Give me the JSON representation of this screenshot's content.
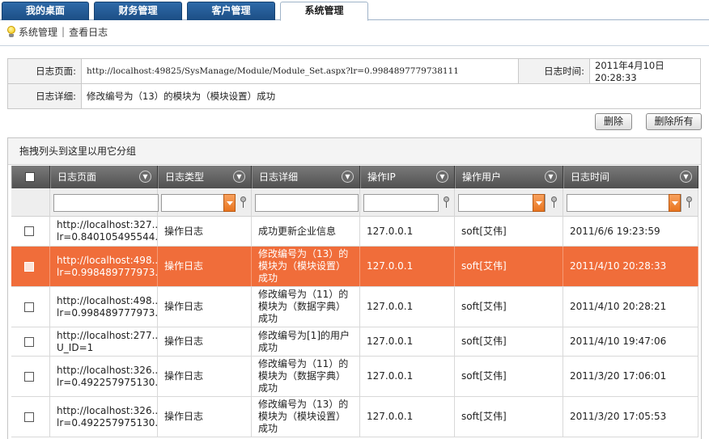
{
  "tabs": [
    {
      "label": "我的桌面",
      "active": false
    },
    {
      "label": "财务管理",
      "active": false
    },
    {
      "label": "客户管理",
      "active": false
    },
    {
      "label": "系统管理",
      "active": true
    }
  ],
  "breadcrumb": {
    "section": "系统管理",
    "separator": "|",
    "page": "查看日志"
  },
  "detail": {
    "page_label": "日志页面:",
    "page_value": "http://localhost:49825/SysManage/Module/Module_Set.aspx?lr=0.9984897779738111",
    "time_label": "日志时间:",
    "time_value": "2011年4月10日 20:28:33",
    "desc_label": "日志详细:",
    "desc_value": "修改编号为（13）的模块为（模块设置）成功"
  },
  "buttons": {
    "delete": "删除",
    "delete_all": "删除所有"
  },
  "grid": {
    "group_hint": "拖拽列头到这里以用它分组",
    "columns": [
      "日志页面",
      "日志类型",
      "日志详细",
      "操作IP",
      "操作用户",
      "日志时间"
    ],
    "rows": [
      {
        "page": "http://localhost:327...\nlr=0.840105495544...",
        "type": "操作日志",
        "detail": "成功更新企业信息",
        "ip": "127.0.0.1",
        "user": "soft[艾伟]",
        "time": "2011/6/6 19:23:59",
        "selected": false
      },
      {
        "page": "http://localhost:498...\nlr=0.998489777973...",
        "type": "操作日志",
        "detail": "修改编号为（13）的模块为（模块设置）成功",
        "ip": "127.0.0.1",
        "user": "soft[艾伟]",
        "time": "2011/4/10 20:28:33",
        "selected": true
      },
      {
        "page": "http://localhost:498...\nlr=0.998489777973...",
        "type": "操作日志",
        "detail": "修改编号为（11）的模块为（数据字典）成功",
        "ip": "127.0.0.1",
        "user": "soft[艾伟]",
        "time": "2011/4/10 20:28:21",
        "selected": false
      },
      {
        "page": "http://localhost:277...\nU_ID=1",
        "type": "操作日志",
        "detail": "修改编号为[1]的用户成功",
        "ip": "127.0.0.1",
        "user": "soft[艾伟]",
        "time": "2011/4/10 19:47:06",
        "selected": false
      },
      {
        "page": "http://localhost:326...\nlr=0.492257975130...",
        "type": "操作日志",
        "detail": "修改编号为（11）的模块为（数据字典）成功",
        "ip": "127.0.0.1",
        "user": "soft[艾伟]",
        "time": "2011/3/20 17:06:01",
        "selected": false
      },
      {
        "page": "http://localhost:326...\nlr=0.492257975130...",
        "type": "操作日志",
        "detail": "修改编号为（13）的模块为（模块设置）成功",
        "ip": "127.0.0.1",
        "user": "soft[艾伟]",
        "time": "2011/3/20 17:05:53",
        "selected": false
      }
    ]
  },
  "colors": {
    "tab_blue": "#1c4e85",
    "selected_row": "#f06d3a",
    "header_gray": "#5a5a5a",
    "filter_orange": "#e9751f"
  }
}
